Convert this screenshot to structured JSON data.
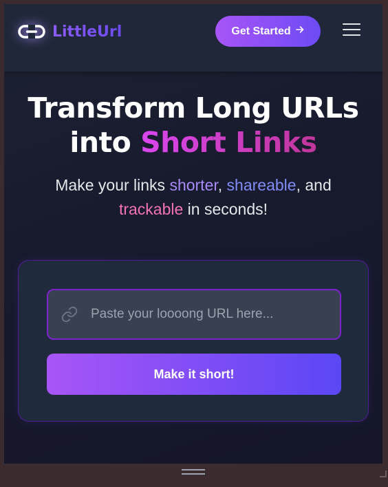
{
  "brand": {
    "name": "LittleUrl",
    "icon": "link-icon"
  },
  "nav": {
    "cta_label": "Get Started",
    "cta_icon": "arrow-right-icon",
    "menu_icon": "hamburger-menu-icon"
  },
  "hero": {
    "title_line1": "Transform Long URLs",
    "title_line2_prefix": "into ",
    "title_line2_accent": "Short Links",
    "subtitle_part1": "Make your links ",
    "subtitle_word1": "shorter",
    "subtitle_part2": ", ",
    "subtitle_word2": "shareable",
    "subtitle_part3": ", and",
    "subtitle_word3": "trackable",
    "subtitle_part4": " in seconds!"
  },
  "form": {
    "url_value": "",
    "url_placeholder": "Paste your loooong URL here...",
    "url_icon": "link-icon",
    "submit_label": "Make it short!"
  },
  "colors": {
    "brand_purple": "#8b5cf6",
    "accent_pink": "#d946ef",
    "word_shorter": "#a78bfa",
    "word_shareable": "#818cf8",
    "word_trackable": "#f472b6"
  }
}
